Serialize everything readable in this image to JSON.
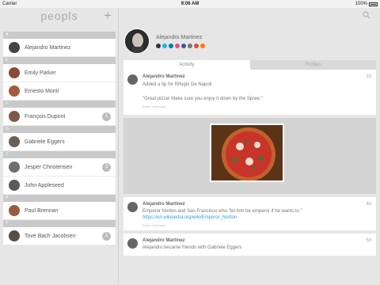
{
  "status": {
    "carrier": "Carrier",
    "time": "9:06 AM",
    "battery": "100%"
  },
  "app": {
    "title": "peopls",
    "add_label": "+"
  },
  "contacts": [
    {
      "section": "A",
      "people": [
        {
          "name": "Alejandro Martinez",
          "badge": ""
        }
      ]
    },
    {
      "section": "E",
      "people": [
        {
          "name": "Emily Parker",
          "badge": ""
        },
        {
          "name": "Ernesto Monti",
          "badge": ""
        }
      ]
    },
    {
      "section": "F",
      "people": [
        {
          "name": "François Dupont",
          "badge": "1"
        }
      ]
    },
    {
      "section": "G",
      "people": [
        {
          "name": "Gabriele Eggers",
          "badge": ""
        }
      ]
    },
    {
      "section": "J",
      "people": [
        {
          "name": "Jesper Christensen",
          "badge": "3"
        },
        {
          "name": "John Appleseed",
          "badge": ""
        }
      ]
    },
    {
      "section": "P",
      "people": [
        {
          "name": "Paul Brennan",
          "badge": ""
        }
      ]
    },
    {
      "section": "T",
      "people": [
        {
          "name": "Tove Bach Jacobsen",
          "badge": "1"
        }
      ]
    }
  ],
  "profile": {
    "name": "Alejandro Martinez"
  },
  "tabs": {
    "activity": "Activity",
    "profiles": "Profiles"
  },
  "feed": {
    "item1": {
      "author": "Alejandro Martinez",
      "line1": "Added a tip for Rifugio De Napoli",
      "quote": "\"Great pizza! Make sure you enjoy it down by the Spree.\"",
      "location": "Berlin, Germany",
      "age": "2d"
    },
    "item2": {
      "author": "Alejandro Martinez",
      "text": "Emperor Norton and San Francisco who \"let him be emperor if he wants to.\"",
      "link": "https://en.wikipedia.org/wiki/Emperor_Norton",
      "location": "Berlin, Germany",
      "age": "4d"
    },
    "item3": {
      "author": "Alejandro Martinez",
      "text": "Alejandro became friends with Gabriele Eggers",
      "age": "5d"
    }
  },
  "colors": {
    "accent": "#2aa3d8",
    "section": "#c9c9c9"
  }
}
